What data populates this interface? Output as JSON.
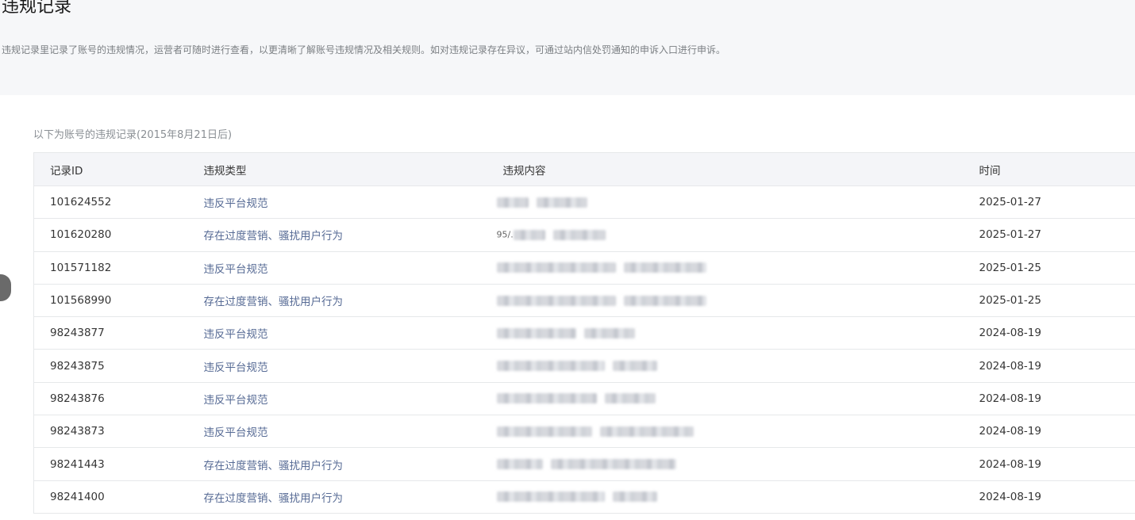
{
  "page": {
    "title": "违规记录",
    "description": "违规记录里记录了账号的违规情况，运营者可随时进行查看，以更清晰了解账号违规情况及相关规则。如对违规记录存在异议，可通过站内信处罚通知的申诉入口进行申诉。"
  },
  "table": {
    "caption": "以下为账号的违规记录(2015年8月21日后)",
    "headers": {
      "id": "记录ID",
      "type": "违规类型",
      "content": "违规内容",
      "time": "时间"
    },
    "rows": [
      {
        "id": "101624552",
        "type": "违反平台规范",
        "content_prefix": "",
        "time": "2025-01-27"
      },
      {
        "id": "101620280",
        "type": "存在过度营销、骚扰用户行为",
        "content_prefix": "95/.",
        "time": "2025-01-27"
      },
      {
        "id": "101571182",
        "type": "违反平台规范",
        "content_prefix": "",
        "time": "2025-01-25"
      },
      {
        "id": "101568990",
        "type": "存在过度营销、骚扰用户行为",
        "content_prefix": "",
        "time": "2025-01-25"
      },
      {
        "id": "98243877",
        "type": "违反平台规范",
        "content_prefix": "",
        "time": "2024-08-19"
      },
      {
        "id": "98243875",
        "type": "违反平台规范",
        "content_prefix": "",
        "time": "2024-08-19"
      },
      {
        "id": "98243876",
        "type": "违反平台规范",
        "content_prefix": "",
        "time": "2024-08-19"
      },
      {
        "id": "98243873",
        "type": "违反平台规范",
        "content_prefix": "",
        "time": "2024-08-19"
      },
      {
        "id": "98241443",
        "type": "存在过度营销、骚扰用户行为",
        "content_prefix": "",
        "time": "2024-08-19"
      },
      {
        "id": "98241400",
        "type": "存在过度营销、骚扰用户行为",
        "content_prefix": "",
        "time": "2024-08-19"
      }
    ]
  }
}
